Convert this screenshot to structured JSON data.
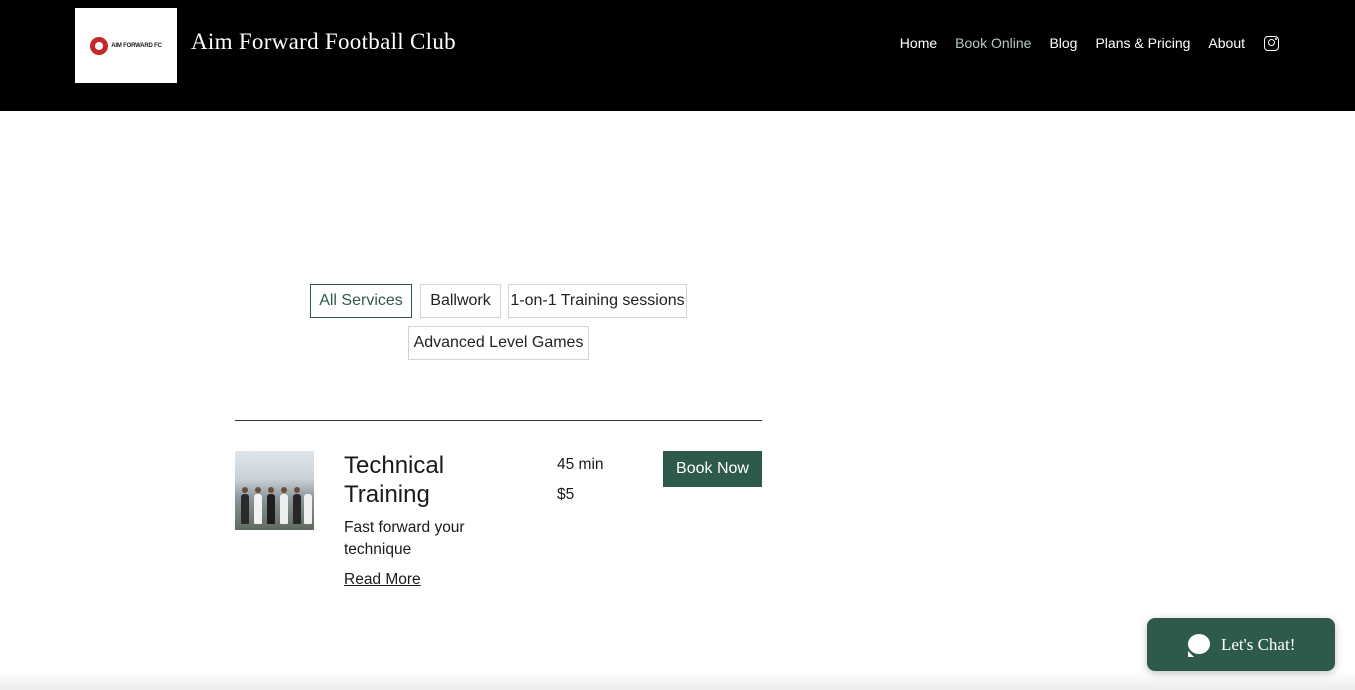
{
  "header": {
    "logo_text": "AIM FORWARD FC",
    "site_title": "Aim Forward Football Club",
    "nav": [
      {
        "label": "Home"
      },
      {
        "label": "Book Online"
      },
      {
        "label": "Blog"
      },
      {
        "label": "Plans & Pricing"
      },
      {
        "label": "About"
      }
    ],
    "social_icon": "instagram-icon"
  },
  "filters": {
    "chips": [
      {
        "label": "All Services",
        "selected": true
      },
      {
        "label": "Ballwork",
        "selected": false
      },
      {
        "label": "1-on-1 Training sessions",
        "selected": false
      },
      {
        "label": "Advanced Level Games",
        "selected": false
      }
    ]
  },
  "service": {
    "title": "Technical Training",
    "description": "Fast forward your technique",
    "read_more": "Read More",
    "duration": "45 min",
    "price": "$5",
    "book_label": "Book Now"
  },
  "chat": {
    "label": "Let's Chat!"
  },
  "colors": {
    "header_bg": "#000000",
    "accent": "#2e5a4c",
    "nav_active": "#b9c8c2",
    "logo_red": "#c62828"
  }
}
